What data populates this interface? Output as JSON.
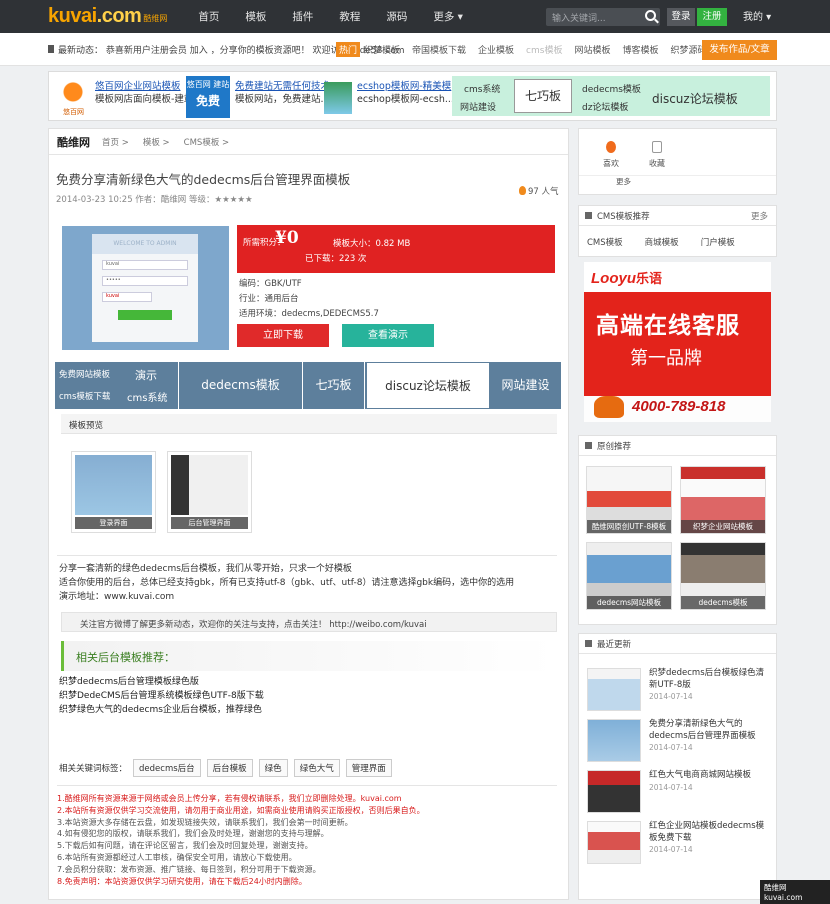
{
  "topnav": {
    "logo_text": "kuvai",
    "logo_dot": ".com",
    "logo_sub": "酷维网",
    "links": [
      "首页",
      "模板",
      "插件",
      "教程",
      "源码",
      "更多 ▾"
    ],
    "search_placeholder": "输入关键词...",
    "login": "登录",
    "register": "注册",
    "mine": "我的 ▾"
  },
  "announce": {
    "text": "最新动态： 恭喜新用户注册会员 加入 ，分享你的模板资源吧！ 欢迎访问dede58.com",
    "hot": "热门",
    "tags": [
      "织梦模板",
      "帝国模板下载",
      "企业模板",
      "cms模板",
      "网站模板",
      "博客模板",
      "织梦源码"
    ],
    "submit": "发布作品/文章"
  },
  "ads": {
    "a1_cap": "悠百网",
    "a1_l1": "悠百网企业网站模板",
    "a1_l2": "模板网店面向模板-建站",
    "a2_badge": "悠百网 建站",
    "a2_big": "免费",
    "a2_l1": "免费建站无需任何技术",
    "a2_l2": "模板网站，免费建站...",
    "a3_l1": "ecshop模板网-精美模",
    "a3_l2": "ecshop模板网-ecsh...",
    "a4_c1": "cms系统",
    "a4_c2": "网站建设",
    "a4_box": "七巧板",
    "a4_c3": "dedecms模板",
    "a4_c4": "dz论坛模板",
    "a4_c5": "discuz论坛模板"
  },
  "crumb": {
    "section": "酷维网",
    "items": [
      "首页 >",
      "模板 >",
      "CMS模板 >"
    ]
  },
  "article": {
    "title": "免费分享清新绿色大气的dedecms后台管理界面模板",
    "meta": "2014-03-23 10:25   作者：酷维网   等级：★★★★★",
    "views": "97 人气",
    "price_label": "所需积分：",
    "price": "¥0",
    "size": "模板大小：0.82 MB",
    "points": "已下载：223 次",
    "info1": "编码：GBK/UTF",
    "info2": "行业：通用后台",
    "info3": "适用环境：dedecms,DEDECMS5.7",
    "download": "立即下载",
    "demo": "查看演示",
    "shot_header": "WELCOME TO ADMIN",
    "shot_user": "kuvai",
    "shot_pass": "•••••",
    "shot_code": "kuvai"
  },
  "adrow": {
    "c1a": "免费网站模板",
    "c1b": "cms模板下载",
    "c1c": "演示",
    "c1d": "cms系统",
    "c2": "dedecms模板",
    "c3": "七巧板",
    "c4": "discuz论坛模板",
    "c5": "网站建设"
  },
  "preview": {
    "section": "模板预览",
    "thumbs": [
      "登录界面",
      "后台管理界面"
    ]
  },
  "desc": {
    "l1": "分享一套清新的绿色dedecms后台模板，我们从零开始，只求一个好模板",
    "l2": "适合你使用的后台，总体已经支持gbk，所有已支持utf-8（gbk、utf、utf-8）请注意选择gbk编码，选中你的选用",
    "l3": "演示地址：www.kuvai.com"
  },
  "weibo": "关注官方微博了解更多新动态，欢迎你的关注与支持，点击关注！ http://weibo.com/kuvai",
  "related": {
    "heading": "相关后台模板推荐：",
    "items": [
      "织梦dedecms后台管理模板绿色版",
      "织梦DedeCMS后台管理系统模板绿色UTF-8版下载",
      "织梦绿色大气的dedecms企业后台模板，推荐绿色"
    ]
  },
  "keywords": {
    "label": "相关关键词标签：",
    "tags": [
      "dedecms后台",
      "后台模板",
      "绿色",
      "绿色大气",
      "管理界面"
    ]
  },
  "notes": [
    {
      "t": "1.酷维网所有资源来源于网络或会员上传分享，若有侵权请联系，我们立即删除处理。kuvai.com",
      "c": "red"
    },
    {
      "t": "2.本站所有资源仅供学习交流使用，请勿用于商业用途，如需商业使用请购买正版授权，否则后果自负。",
      "c": "red"
    },
    {
      "t": "3.本站资源大多存储在云盘，如发现链接失效，请联系我们，我们会第一时间更新。",
      "c": "gray"
    },
    {
      "t": "4.如有侵犯您的版权，请联系我们，我们会及时处理，谢谢您的支持与理解。",
      "c": "gray"
    },
    {
      "t": "5.下载后如有问题，请在评论区留言，我们会及时回复处理，谢谢支持。",
      "c": "gray"
    },
    {
      "t": "6.本站所有资源都经过人工审核，确保安全可用，请放心下载使用。",
      "c": "gray"
    },
    {
      "t": "7.会员积分获取：发布资源、推广链接、每日签到，积分可用于下载资源。",
      "c": "gray"
    },
    {
      "t": "8.免责声明：本站资源仅供学习研究使用，请在下载后24小时内删除。",
      "c": "red"
    }
  ],
  "sidebar": {
    "fav1": "喜欢",
    "fav2": "收藏",
    "more": "更多",
    "cms_title": "CMS模板推荐",
    "cms_more": "更多",
    "cms_links": [
      "CMS模板",
      "商城模板",
      "门户模板"
    ],
    "looyu_logo": "Looyu",
    "looyu_cn": "乐语",
    "looyu_h1": "高端在线客服",
    "looyu_h2": "第一品牌",
    "looyu_tel": "4000-789-818",
    "guide_title": "原创推荐",
    "guide": [
      "酷维网原创UTF-8模板",
      "织梦企业网站模板",
      "dedecms网站模板",
      "dedecms模板"
    ],
    "latest_title": "最近更新",
    "latest": [
      {
        "t": "织梦dedecms后台模板绿色清新UTF-8版",
        "d": "2014-07-14"
      },
      {
        "t": "免费分享清新绿色大气的dedecms后台管理界面模板",
        "d": "2014-07-14"
      },
      {
        "t": "红色大气电商商城网站模板",
        "d": "2014-07-14"
      },
      {
        "t": "红色企业网站模板dedecms模板免费下载",
        "d": "2014-07-14"
      }
    ]
  },
  "watermark": "酷维网 kuvai.com"
}
